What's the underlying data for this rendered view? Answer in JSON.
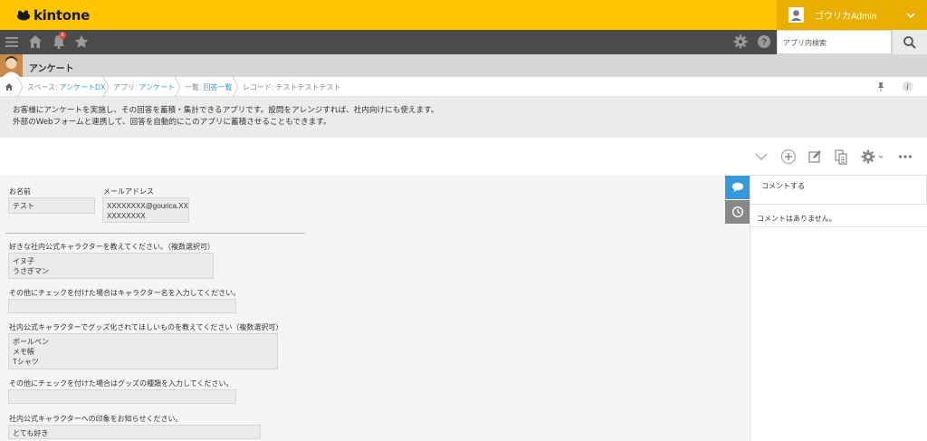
{
  "header": {
    "logo_text": "kintone",
    "user_name": "ゴウリカAdmin",
    "brand_color": "#ffc500"
  },
  "nav": {
    "icons": [
      "menu-icon",
      "home-icon",
      "bell-icon",
      "star-icon",
      "gear-icon",
      "help-icon",
      "search-icon"
    ],
    "notification_count": "5",
    "search_placeholder": "アプリ内検索"
  },
  "app": {
    "title": "アンケート"
  },
  "breadcrumb": {
    "space_label": "スペース: ",
    "space_link": "アンケートDX",
    "app_label": "アプリ: ",
    "app_link": "アンケート",
    "list_label": "一覧: ",
    "list_link": "回答一覧",
    "record_label": "レコード: テストテストテスト"
  },
  "description": {
    "line1": "お客様にアンケートを実施し、その回答を蓄積・集計できるアプリです。設問をアレンジすれば、社内向けにも使えます。",
    "line2": "外部のWebフォームと連携して、回答を自動的にこのアプリに蓄積させることもできます。"
  },
  "toolbar": {
    "icons": [
      "chevron-down-icon",
      "add-icon",
      "edit-icon",
      "copy-icon",
      "settings-icon",
      "more-icon"
    ]
  },
  "form": {
    "name_label": "お名前",
    "name_value": "テスト",
    "email_label": "メールアドレス",
    "email_line1": "XXXXXXXX@gourica.XX",
    "email_line2": "XXXXXXXX",
    "q1_label": "好きな社内公式キャラクターを教えてください。（複数選択可）",
    "q1_values": [
      "イヌ子",
      "うさぎマン"
    ],
    "q2_label": "その他にチェックを付けた場合はキャラクター名を入力してください。",
    "q2_value": "",
    "q3_label": "社内公式キャラクターでグッズ化されてほしいものを教えてください（複数選択可）",
    "q3_values": [
      "ボールペン",
      "メモ帳",
      "Tシャツ"
    ],
    "q4_label": "その他にチェックを付けた場合はグッズの種類を入力してください。",
    "q4_value": "",
    "q5_label": "社内公式キャラクターへの印象をお知らせください。",
    "q5_value": "とても好き"
  },
  "comments": {
    "input_placeholder": "コメントする",
    "empty_text": "コメントはありません。"
  }
}
